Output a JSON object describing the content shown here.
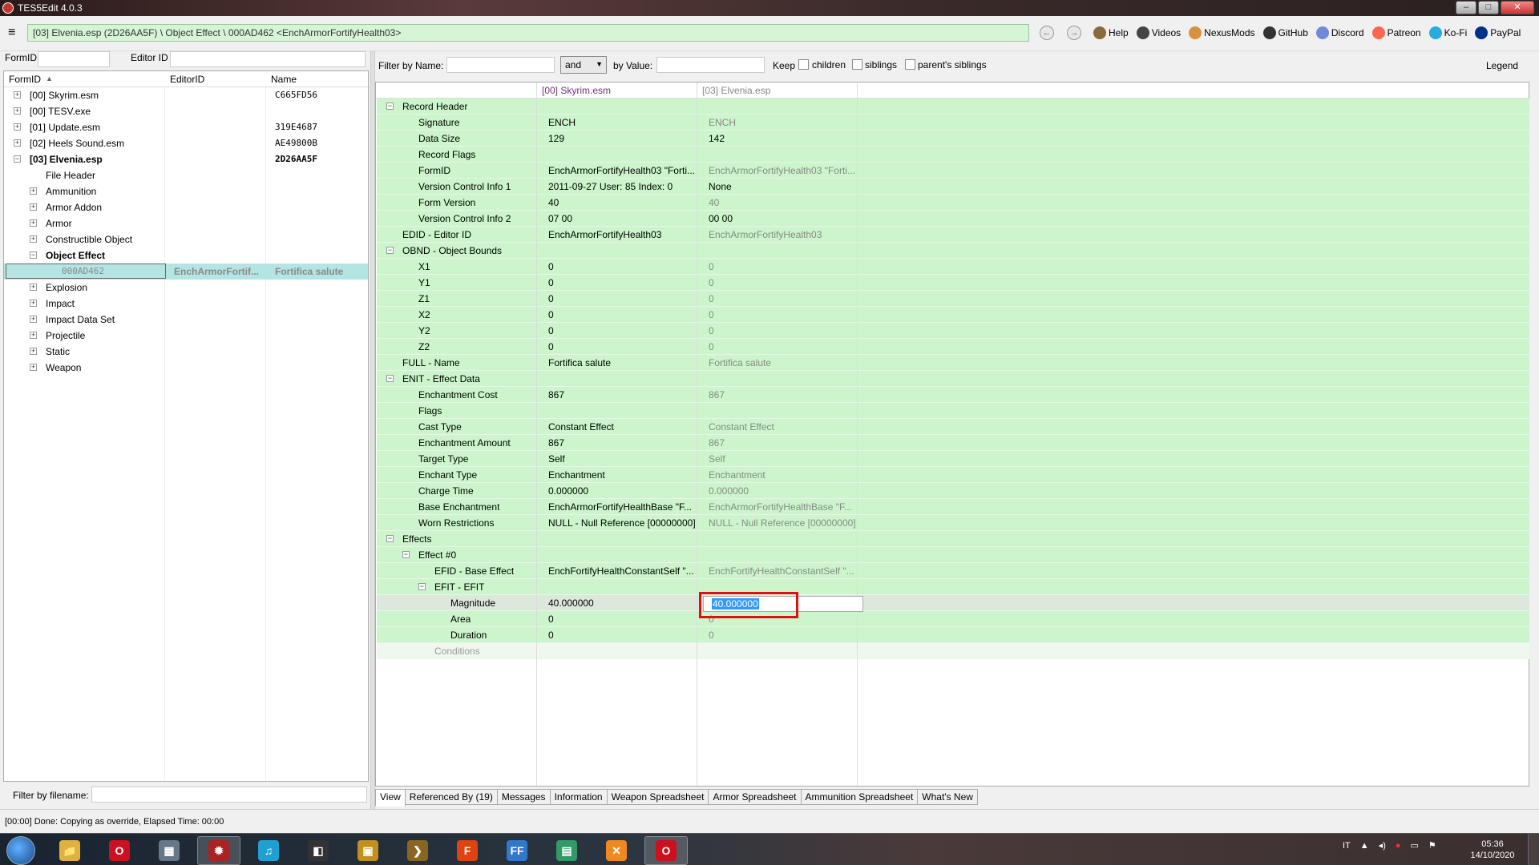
{
  "window": {
    "title": "TES5Edit 4.0.3",
    "controls": [
      "–",
      "□",
      "✕"
    ]
  },
  "toolbar": {
    "menu_icon": "≡",
    "path": "[03] Elvenia.esp (2D26AA5F) \\ Object Effect \\ 000AD462 <EnchArmorFortifyHealth03>",
    "back_icon": "←",
    "forward_icon": "→",
    "links": [
      {
        "label": "Help",
        "icon": "book-icon",
        "color": "#8a6a3a"
      },
      {
        "label": "Videos",
        "icon": "videos-icon",
        "color": "#444444"
      },
      {
        "label": "NexusMods",
        "icon": "nexusmods-icon",
        "color": "#d98f40"
      },
      {
        "label": "GitHub",
        "icon": "github-icon",
        "color": "#333333"
      },
      {
        "label": "Discord",
        "icon": "discord-icon",
        "color": "#7289da"
      },
      {
        "label": "Patreon",
        "icon": "patreon-icon",
        "color": "#f96854"
      },
      {
        "label": "Ko-Fi",
        "icon": "kofi-icon",
        "color": "#29abe0"
      },
      {
        "label": "PayPal",
        "icon": "paypal-icon",
        "color": "#003087"
      }
    ]
  },
  "left": {
    "formid_label": "FormID",
    "formid_value": "",
    "editorid_label": "Editor ID",
    "editorid_value": "",
    "columns": [
      "FormID",
      "EditorID",
      "Name"
    ],
    "sort_icon": "▲",
    "filter_filename_label": "Filter by filename:",
    "filter_filename_value": "",
    "tree": [
      {
        "label": "[00] Skyrim.esm",
        "col3": "C665FD56",
        "bold": false
      },
      {
        "label": "[00] TESV.exe",
        "col3": "",
        "bold": false
      },
      {
        "label": "[01] Update.esm",
        "col3": "319E4687",
        "bold": false
      },
      {
        "label": "[02] Heels Sound.esm",
        "col3": "AE49800B",
        "bold": false
      },
      {
        "label": "[03] Elvenia.esp",
        "col3": "2D26AA5F",
        "bold": true
      },
      {
        "label": "File Header",
        "bold": false
      },
      {
        "label": "Ammunition",
        "bold": false
      },
      {
        "label": "Armor Addon",
        "bold": false
      },
      {
        "label": "Armor",
        "bold": false
      },
      {
        "label": "Constructible Object",
        "bold": false
      },
      {
        "label": "Object Effect",
        "bold": true
      },
      {
        "label": "000AD462",
        "editorid": "EnchArmorFortif...",
        "name": "Fortifica salute"
      },
      {
        "label": "Explosion",
        "bold": false
      },
      {
        "label": "Impact",
        "bold": false
      },
      {
        "label": "Impact Data Set",
        "bold": false
      },
      {
        "label": "Projectile",
        "bold": false
      },
      {
        "label": "Static",
        "bold": false
      },
      {
        "label": "Weapon",
        "bold": false
      }
    ]
  },
  "filter": {
    "by_name_label": "Filter by Name:",
    "name_value": "",
    "logic": "and",
    "by_value_label": "by Value:",
    "value_value": "",
    "keep_label": "Keep",
    "children_label": "children",
    "siblings_label": "siblings",
    "parents_siblings_label": "parent's siblings",
    "legend_label": "Legend"
  },
  "grid": {
    "col1_header": "[00] Skyrim.esm",
    "col2_header": "[03] Elvenia.esp",
    "rows": [
      {
        "label": "Record Header",
        "v1": "",
        "v2": ""
      },
      {
        "label": "Signature",
        "v1": "ENCH",
        "v2": "ENCH"
      },
      {
        "label": "Data Size",
        "v1": "129",
        "v2": "142"
      },
      {
        "label": "Record Flags",
        "v1": "",
        "v2": ""
      },
      {
        "label": "FormID",
        "v1": "EnchArmorFortifyHealth03 \"Forti...",
        "v2": "EnchArmorFortifyHealth03 \"Forti..."
      },
      {
        "label": "Version Control Info 1",
        "v1": "2011-09-27 User: 85 Index: 0",
        "v2": "None"
      },
      {
        "label": "Form Version",
        "v1": "40",
        "v2": "40"
      },
      {
        "label": "Version Control Info 2",
        "v1": "07 00",
        "v2": "00 00"
      },
      {
        "label": "EDID - Editor ID",
        "v1": "EnchArmorFortifyHealth03",
        "v2": "EnchArmorFortifyHealth03"
      },
      {
        "label": "OBND - Object Bounds",
        "v1": "",
        "v2": ""
      },
      {
        "label": "X1",
        "v1": "0",
        "v2": "0"
      },
      {
        "label": "Y1",
        "v1": "0",
        "v2": "0"
      },
      {
        "label": "Z1",
        "v1": "0",
        "v2": "0"
      },
      {
        "label": "X2",
        "v1": "0",
        "v2": "0"
      },
      {
        "label": "Y2",
        "v1": "0",
        "v2": "0"
      },
      {
        "label": "Z2",
        "v1": "0",
        "v2": "0"
      },
      {
        "label": "FULL - Name",
        "v1": "Fortifica salute",
        "v2": "Fortifica salute"
      },
      {
        "label": "ENIT - Effect Data",
        "v1": "",
        "v2": ""
      },
      {
        "label": "Enchantment Cost",
        "v1": "867",
        "v2": "867"
      },
      {
        "label": "Flags",
        "v1": "",
        "v2": ""
      },
      {
        "label": "Cast Type",
        "v1": "Constant Effect",
        "v2": "Constant Effect"
      },
      {
        "label": "Enchantment Amount",
        "v1": "867",
        "v2": "867"
      },
      {
        "label": "Target Type",
        "v1": "Self",
        "v2": "Self"
      },
      {
        "label": "Enchant Type",
        "v1": "Enchantment",
        "v2": "Enchantment"
      },
      {
        "label": "Charge Time",
        "v1": "0.000000",
        "v2": "0.000000"
      },
      {
        "label": "Base Enchantment",
        "v1": "EnchArmorFortifyHealthBase \"F...",
        "v2": "EnchArmorFortifyHealthBase \"F..."
      },
      {
        "label": "Worn Restrictions",
        "v1": "NULL - Null Reference [00000000]",
        "v2": "NULL - Null Reference [00000000]"
      },
      {
        "label": "Effects",
        "v1": "",
        "v2": ""
      },
      {
        "label": "Effect #0",
        "v1": "",
        "v2": ""
      },
      {
        "label": "EFID - Base Effect",
        "v1": "EnchFortifyHealthConstantSelf \"...",
        "v2": "EnchFortifyHealthConstantSelf \"..."
      },
      {
        "label": "EFIT - EFIT",
        "v1": "",
        "v2": ""
      },
      {
        "label": "Magnitude",
        "v1": "40.000000",
        "v2": "40.000000"
      },
      {
        "label": "Area",
        "v1": "0",
        "v2": "0"
      },
      {
        "label": "Duration",
        "v1": "0",
        "v2": "0"
      },
      {
        "label": "Conditions",
        "v1": "",
        "v2": ""
      }
    ]
  },
  "tabs": [
    "View",
    "Referenced By (19)",
    "Messages",
    "Information",
    "Weapon Spreadsheet",
    "Armor Spreadsheet",
    "Ammunition Spreadsheet",
    "What's New"
  ],
  "status": "[00:00] Done: Copying as override, Elapsed Time: 00:00",
  "taskbar": {
    "apps": [
      {
        "name": "explorer",
        "glyph": "📁",
        "color": "#e0b040"
      },
      {
        "name": "opera",
        "glyph": "O",
        "color": "#cc1020"
      },
      {
        "name": "app-3",
        "glyph": "▦",
        "color": "#667788"
      },
      {
        "name": "tes5edit",
        "glyph": "✹",
        "color": "#aa2222"
      },
      {
        "name": "music",
        "glyph": "♫",
        "color": "#20a0d0"
      },
      {
        "name": "app-6",
        "glyph": "◧",
        "color": "#333333"
      },
      {
        "name": "app-7",
        "glyph": "▣",
        "color": "#c09020"
      },
      {
        "name": "app-8",
        "glyph": "❯",
        "color": "#886622"
      },
      {
        "name": "foxit",
        "glyph": "F",
        "color": "#dd4411"
      },
      {
        "name": "ff-dec",
        "glyph": "FF",
        "color": "#3377cc"
      },
      {
        "name": "app-11",
        "glyph": "▤",
        "color": "#339966"
      },
      {
        "name": "app-12",
        "glyph": "✕",
        "color": "#ee8822"
      },
      {
        "name": "opera-2",
        "glyph": "O",
        "color": "#cc1020"
      }
    ],
    "lang": "IT",
    "time": "05:36",
    "date": "14/10/2020"
  }
}
